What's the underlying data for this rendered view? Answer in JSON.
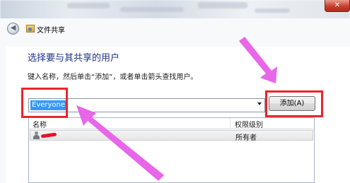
{
  "window": {
    "title": "文件共享",
    "close_label": "✕"
  },
  "icons": {
    "back": "back-arrow-icon",
    "folder_share": "share-folder-icon",
    "user": "user-icon",
    "dropdown": "chevron-down-icon"
  },
  "dialog": {
    "heading": "选择要与其共享的用户",
    "instruction": "键入名称，然后单击“添加”，或者单击箭头查找用户。",
    "combo_value": "Everyone",
    "add_button": "添加(A)",
    "columns": {
      "name": "名称",
      "permission": "权限级别"
    },
    "rows": [
      {
        "permission": "所有者"
      }
    ]
  },
  "colors": {
    "highlight": "#e8262b",
    "arrow": "#e75ee7",
    "heading": "#1e3287",
    "selection": "#3399ff"
  }
}
